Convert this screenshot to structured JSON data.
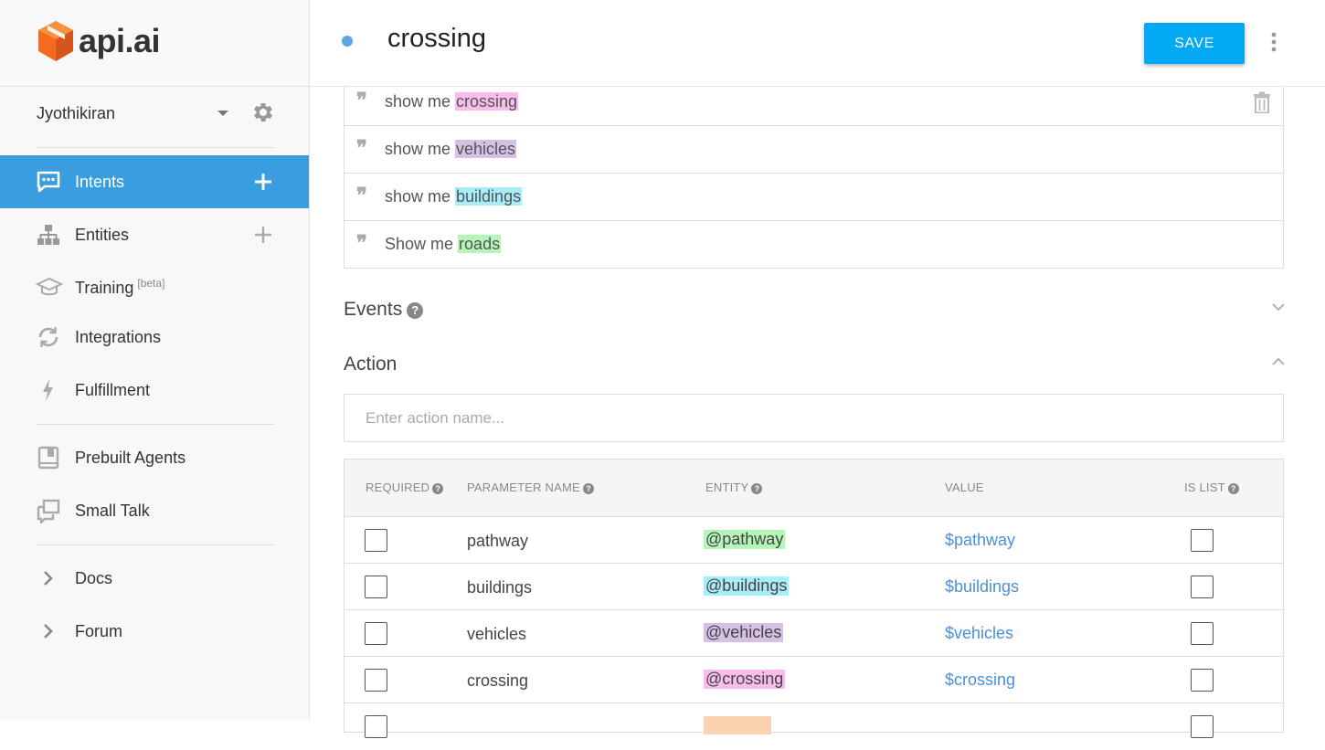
{
  "brand": {
    "name": "api.ai"
  },
  "agent": {
    "name": "Jyothikiran"
  },
  "nav": {
    "intents": "Intents",
    "entities": "Entities",
    "training": "Training",
    "training_badge": "[beta]",
    "integrations": "Integrations",
    "fulfillment": "Fulfillment",
    "prebuilt_agents": "Prebuilt Agents",
    "small_talk": "Small Talk",
    "docs": "Docs",
    "forum": "Forum"
  },
  "header": {
    "title": "crossing",
    "save_label": "SAVE"
  },
  "phrases": [
    {
      "prefix": "show me ",
      "entity": "crossing",
      "color": "#f8bdeb"
    },
    {
      "prefix": "show me ",
      "entity": "vehicles",
      "color": "#d7c0e6"
    },
    {
      "prefix": "show me ",
      "entity": "buildings",
      "color": "#a7ecf8"
    },
    {
      "prefix": "Show me ",
      "entity": "roads",
      "color": "#b4f5b8"
    }
  ],
  "events": {
    "title": "Events"
  },
  "action": {
    "title": "Action",
    "placeholder": "Enter action name..."
  },
  "params": {
    "headers": {
      "required": "REQUIRED",
      "name": "PARAMETER NAME",
      "entity": "ENTITY",
      "value": "VALUE",
      "is_list": "IS LIST"
    },
    "rows": [
      {
        "name": "pathway",
        "entity": "@pathway",
        "value": "$pathway",
        "color": "#b4f5b8"
      },
      {
        "name": "buildings",
        "entity": "@buildings",
        "value": "$buildings",
        "color": "#a7ecf8"
      },
      {
        "name": "vehicles",
        "entity": "@vehicles",
        "value": "$vehicles",
        "color": "#d7c0e6"
      },
      {
        "name": "crossing",
        "entity": "@crossing",
        "value": "$crossing",
        "color": "#f8bdeb"
      }
    ],
    "partial_row_color": "#fcd3b1"
  },
  "colors": {
    "accent": "#3a9ddf",
    "save": "#03a9f4",
    "logo": "#f26b21",
    "link": "#4a90d9"
  }
}
